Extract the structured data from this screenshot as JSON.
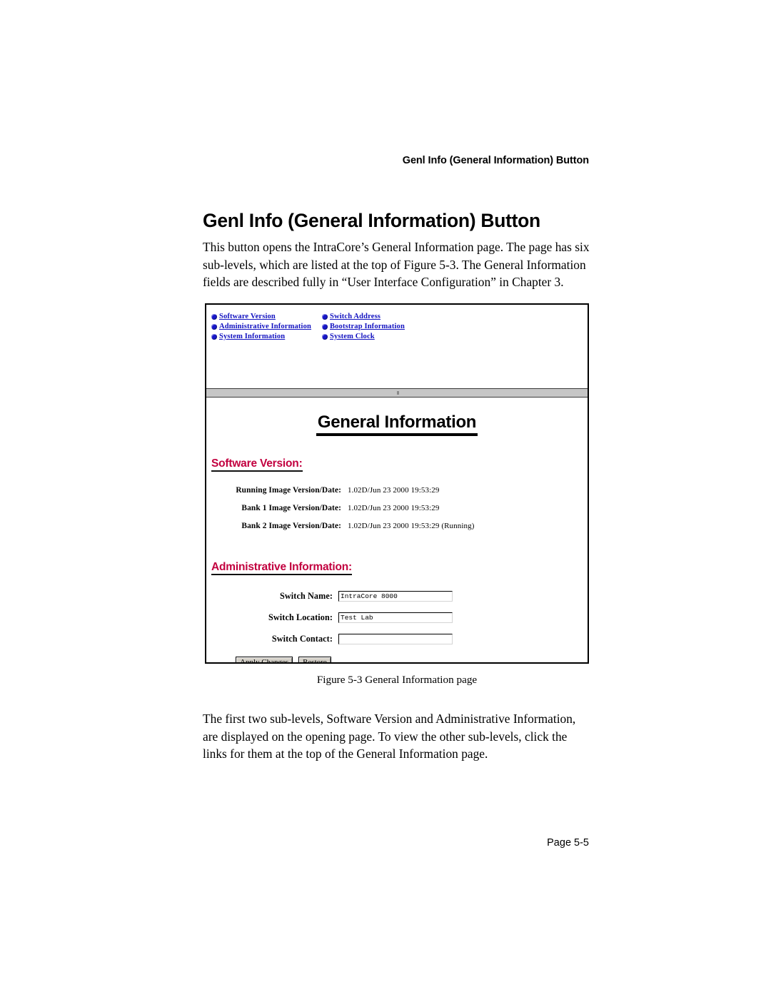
{
  "header": {
    "running_head": "Genl Info (General Information) Button"
  },
  "title": "Genl Info (General Information) Button",
  "paragraphs": {
    "intro": "This button opens the IntraCore’s General Information page. The page has six sub-levels, which are listed at the top of Figure 5-3. The General Information fields are described fully in “User Interface Configuration” in Chapter 3.",
    "closing": "The first two sub-levels, Software Version and Administrative Information, are displayed on the opening page. To view the other sub-levels, click the links for them at the top of the General Information page."
  },
  "figure": {
    "caption": "Figure 5-3   General Information page",
    "nav_links": [
      {
        "label": "Software Version",
        "icon": "bullet-icon"
      },
      {
        "label": "Switch Address",
        "icon": "bullet-icon"
      },
      {
        "label": "Administrative Information",
        "icon": "bullet-icon"
      },
      {
        "label": "Bootstrap Information",
        "icon": "bullet-icon"
      },
      {
        "label": "System Information",
        "icon": "bullet-icon"
      },
      {
        "label": "System Clock",
        "icon": "bullet-icon"
      }
    ],
    "page_heading": "General Information",
    "software_version": {
      "heading": "Software Version:",
      "rows": [
        {
          "label": "Running Image Version/Date:",
          "value": "1.02D/Jun 23 2000 19:53:29"
        },
        {
          "label": "Bank 1 Image Version/Date:",
          "value": "1.02D/Jun 23 2000 19:53:29"
        },
        {
          "label": "Bank 2 Image Version/Date:",
          "value": "1.02D/Jun 23 2000 19:53:29 (Running)"
        }
      ]
    },
    "administrative_information": {
      "heading": "Administrative Information:",
      "fields": [
        {
          "label": "Switch Name:",
          "value": "IntraCore 8000"
        },
        {
          "label": "Switch Location:",
          "value": "Test Lab"
        },
        {
          "label": "Switch Contact:",
          "value": ""
        }
      ],
      "buttons": [
        {
          "label": "Apply Changes"
        },
        {
          "label": "Restore"
        }
      ]
    },
    "colors": {
      "link": "#1212c0",
      "bullet": "#1818c8",
      "section_heading": "#c2003f",
      "divider": "#c6c6c6"
    }
  },
  "footer": {
    "page_number": "Page 5-5"
  }
}
